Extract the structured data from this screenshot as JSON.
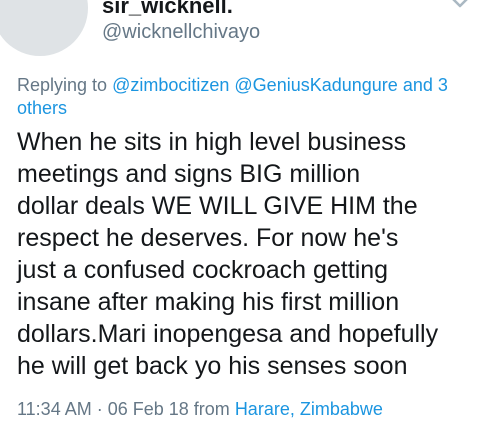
{
  "tweet": {
    "display_name": "sir_wicknell.",
    "handle": "@wicknellchivayo",
    "reply": {
      "prefix": "Replying to",
      "mention_1": "@zimbocitizen",
      "mention_2": "@GeniusKadungure",
      "and_text": "and",
      "others_link": "3 others"
    },
    "body_lines": [
      "When he sits in high level business",
      "meetings and signs BIG million",
      "dollar deals WE WILL GIVE HIM the",
      "respect he deserves. For now he's",
      "just a confused cockroach getting",
      "insane after making his first million",
      "dollars.Mari inopengesa and hopefully",
      "he will get back yo his senses soon"
    ],
    "timestamp": "11:34 AM · 06 Feb 18",
    "from_text": "from",
    "location": "Harare, Zimbabwe"
  },
  "icons": {
    "menu_caret": "chevron-down-icon"
  },
  "colors": {
    "text": "#14171a",
    "secondary": "#657786",
    "link": "#1b95e0"
  }
}
